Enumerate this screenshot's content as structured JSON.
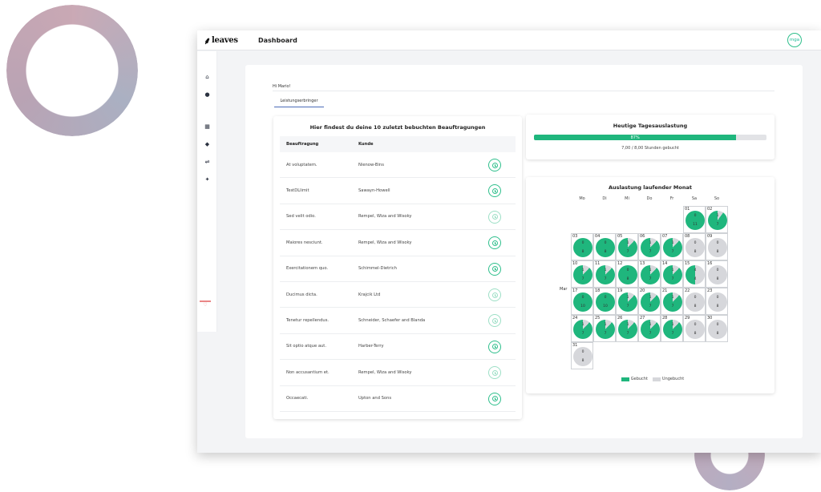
{
  "colors": {
    "booked": "#1fb67d",
    "unbooked": "#d6d7db",
    "accent": "#2fbf8c"
  },
  "app": {
    "logo": "leaves",
    "page_title": "Dashboard",
    "user_initials": "mga"
  },
  "sidebar": {
    "icons": [
      "home-icon",
      "clock-icon",
      "building-icon",
      "layers-icon",
      "person-swap-icon",
      "pin-icon"
    ],
    "active_icon": "heart-icon"
  },
  "greeting": "Hi Mario!",
  "tab": "Leistungserbringer",
  "assignments": {
    "title": "Hier findest du deine 10 zuletzt bebuchten Beauftragungen",
    "headers": {
      "assignment": "Beauftragung",
      "customer": "Kunde"
    },
    "rows": [
      {
        "assignment": "At voluptatem.",
        "customer": "Nienow-Bins",
        "faded": false
      },
      {
        "assignment": "TestDLlimit",
        "customer": "Sawayn-Howell",
        "faded": false
      },
      {
        "assignment": "Sed velit odio.",
        "customer": "Rempel, Wiza and Wisoky",
        "faded": true
      },
      {
        "assignment": "Maiores nesciunt.",
        "customer": "Rempel, Wiza and Wisoky",
        "faded": false
      },
      {
        "assignment": "Exercitationem quo.",
        "customer": "Schimmel-Dietrich",
        "faded": false
      },
      {
        "assignment": "Ducimus dicta.",
        "customer": "Krajcik Ltd",
        "faded": true
      },
      {
        "assignment": "Tenetur repellendus.",
        "customer": "Schneider, Schaefer and Blanda",
        "faded": true
      },
      {
        "assignment": "Sit optio atque aut.",
        "customer": "Harber-Terry",
        "faded": false
      },
      {
        "assignment": "Non accusantium et.",
        "customer": "Rempel, Wiza and Wisoky",
        "faded": true
      },
      {
        "assignment": "Occaecati.",
        "customer": "Upton and Sons",
        "faded": false
      }
    ]
  },
  "daily_load": {
    "title": "Heutige Tagesauslastung",
    "percent": 87,
    "percent_label": "87%",
    "subtitle": "7,00 / 8,00 Stunden gebucht"
  },
  "month": {
    "title": "Auslastung laufender Monat",
    "weekdays": [
      "Mo",
      "Di",
      "Mi",
      "Do",
      "Fr",
      "Sa",
      "So"
    ],
    "month_label": "Mar",
    "legend": {
      "booked": "Gebucht",
      "unbooked": "Ungebucht"
    },
    "days": [
      {
        "day": "01",
        "col": 5,
        "row": 0,
        "booked": 1.0,
        "top": "0",
        "bottom": "11"
      },
      {
        "day": "02",
        "col": 6,
        "row": 0,
        "booked": 0.9,
        "top": "1",
        "bottom": "7"
      },
      {
        "day": "03",
        "col": 0,
        "row": 1,
        "booked": 1.0,
        "top": "0",
        "bottom": "8"
      },
      {
        "day": "04",
        "col": 1,
        "row": 1,
        "booked": 1.0,
        "top": "0",
        "bottom": "8"
      },
      {
        "day": "05",
        "col": 2,
        "row": 1,
        "booked": 0.88,
        "top": "1",
        "bottom": "7"
      },
      {
        "day": "06",
        "col": 3,
        "row": 1,
        "booked": 0.88,
        "top": "1",
        "bottom": "7"
      },
      {
        "day": "07",
        "col": 4,
        "row": 1,
        "booked": 0.88,
        "top": "1",
        "bottom": "7"
      },
      {
        "day": "08",
        "col": 5,
        "row": 1,
        "booked": 0.0,
        "top": "0",
        "bottom": "8"
      },
      {
        "day": "09",
        "col": 6,
        "row": 1,
        "booked": 0.0,
        "top": "0",
        "bottom": "8"
      },
      {
        "day": "10",
        "col": 0,
        "row": 2,
        "booked": 0.88,
        "top": "1",
        "bottom": "7"
      },
      {
        "day": "11",
        "col": 1,
        "row": 2,
        "booked": 0.88,
        "top": "1",
        "bottom": "7"
      },
      {
        "day": "12",
        "col": 2,
        "row": 2,
        "booked": 1.0,
        "top": "0",
        "bottom": "8"
      },
      {
        "day": "13",
        "col": 3,
        "row": 2,
        "booked": 0.88,
        "top": "1",
        "bottom": "7"
      },
      {
        "day": "14",
        "col": 4,
        "row": 2,
        "booked": 0.88,
        "top": "1",
        "bottom": "7"
      },
      {
        "day": "15",
        "col": 5,
        "row": 2,
        "booked": 0.5,
        "top": "4",
        "bottom": "4"
      },
      {
        "day": "16",
        "col": 6,
        "row": 2,
        "booked": 0.0,
        "top": "0",
        "bottom": "8"
      },
      {
        "day": "17",
        "col": 0,
        "row": 3,
        "booked": 1.0,
        "top": "0",
        "bottom": "10"
      },
      {
        "day": "18",
        "col": 1,
        "row": 3,
        "booked": 1.0,
        "top": "0",
        "bottom": "10"
      },
      {
        "day": "19",
        "col": 2,
        "row": 3,
        "booked": 0.88,
        "top": "1",
        "bottom": "7"
      },
      {
        "day": "20",
        "col": 3,
        "row": 3,
        "booked": 0.88,
        "top": "1",
        "bottom": "7"
      },
      {
        "day": "21",
        "col": 4,
        "row": 3,
        "booked": 0.88,
        "top": "1",
        "bottom": "7"
      },
      {
        "day": "22",
        "col": 5,
        "row": 3,
        "booked": 0.0,
        "top": "0",
        "bottom": "8"
      },
      {
        "day": "23",
        "col": 6,
        "row": 3,
        "booked": 0.0,
        "top": "0",
        "bottom": "8"
      },
      {
        "day": "24",
        "col": 0,
        "row": 4,
        "booked": 0.88,
        "top": "1",
        "bottom": "7"
      },
      {
        "day": "25",
        "col": 1,
        "row": 4,
        "booked": 0.88,
        "top": "1",
        "bottom": "7"
      },
      {
        "day": "26",
        "col": 2,
        "row": 4,
        "booked": 0.88,
        "top": "1",
        "bottom": "7"
      },
      {
        "day": "27",
        "col": 3,
        "row": 4,
        "booked": 0.88,
        "top": "1",
        "bottom": "7"
      },
      {
        "day": "28",
        "col": 4,
        "row": 4,
        "booked": 0.88,
        "top": "1",
        "bottom": "7"
      },
      {
        "day": "29",
        "col": 5,
        "row": 4,
        "booked": 0.0,
        "top": "0",
        "bottom": "8"
      },
      {
        "day": "30",
        "col": 6,
        "row": 4,
        "booked": 0.0,
        "top": "0",
        "bottom": "8"
      },
      {
        "day": "31",
        "col": 0,
        "row": 5,
        "booked": 0.0,
        "top": "0",
        "bottom": "8"
      }
    ]
  }
}
